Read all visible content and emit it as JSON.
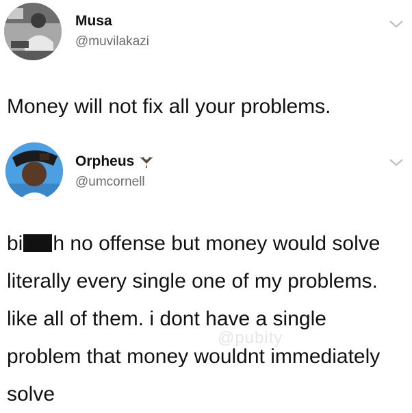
{
  "tweets": [
    {
      "name": "Musa",
      "handle": "@muvilakazi",
      "text": "Money will not fix all your problems."
    },
    {
      "name": "Orpheus",
      "badge_icon": "bat-icon",
      "handle": "@umcornell",
      "text_prefix": "bi",
      "text_suffix": "h no offense but money would solve literally every single one of my problems. like all of them. i dont have a single problem that money wouldnt immediately solve"
    }
  ],
  "watermark": "@pubity",
  "colors": {
    "text": "#111111",
    "handle": "#6b6b6b",
    "chevron": "#b8b8b8",
    "background": "#ffffff"
  }
}
